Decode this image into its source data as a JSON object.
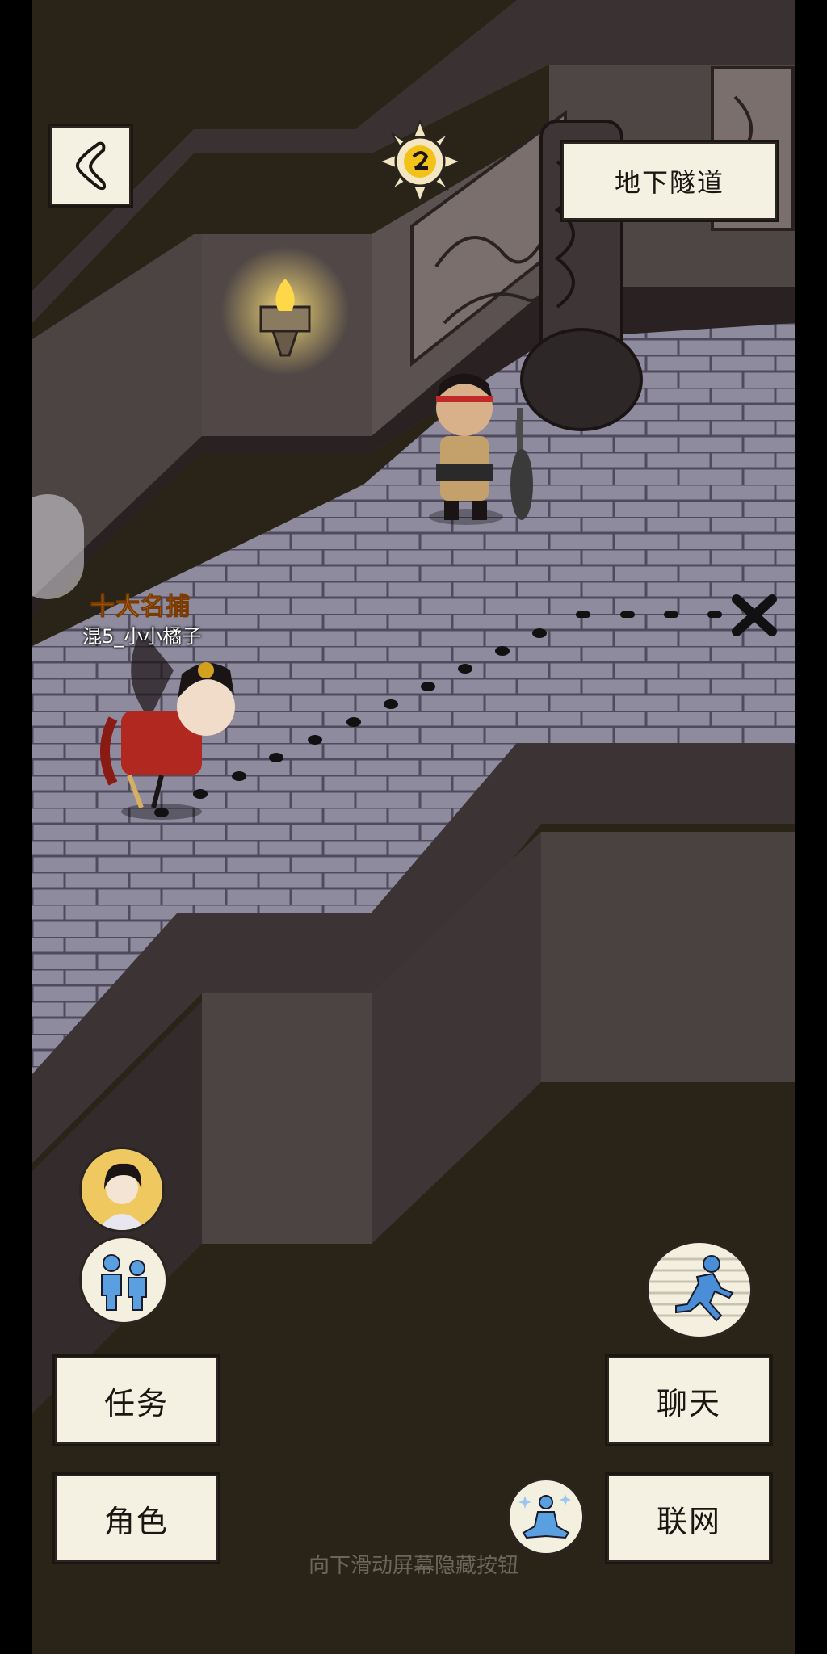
{
  "location": {
    "label": "地下隧道"
  },
  "player": {
    "title": "十大名捕",
    "name": "混5_小小橘子"
  },
  "buttons": {
    "quest": "任务",
    "role": "角色",
    "chat": "聊天",
    "network": "联网"
  },
  "hint": "向下滑动屏幕隐藏按钮",
  "icons": {
    "back": "back-arrow-icon",
    "sun_badge": "sun-icon",
    "party": "party-members-icon",
    "run": "running-icon",
    "meditate": "meditation-icon",
    "destination": "destination-x-icon"
  },
  "colors": {
    "background": "#2a2418",
    "floor": "#8e8a9c",
    "wall": "#4a4240",
    "paper": "#f5f1e2",
    "title_orange": "#f39a2c"
  }
}
